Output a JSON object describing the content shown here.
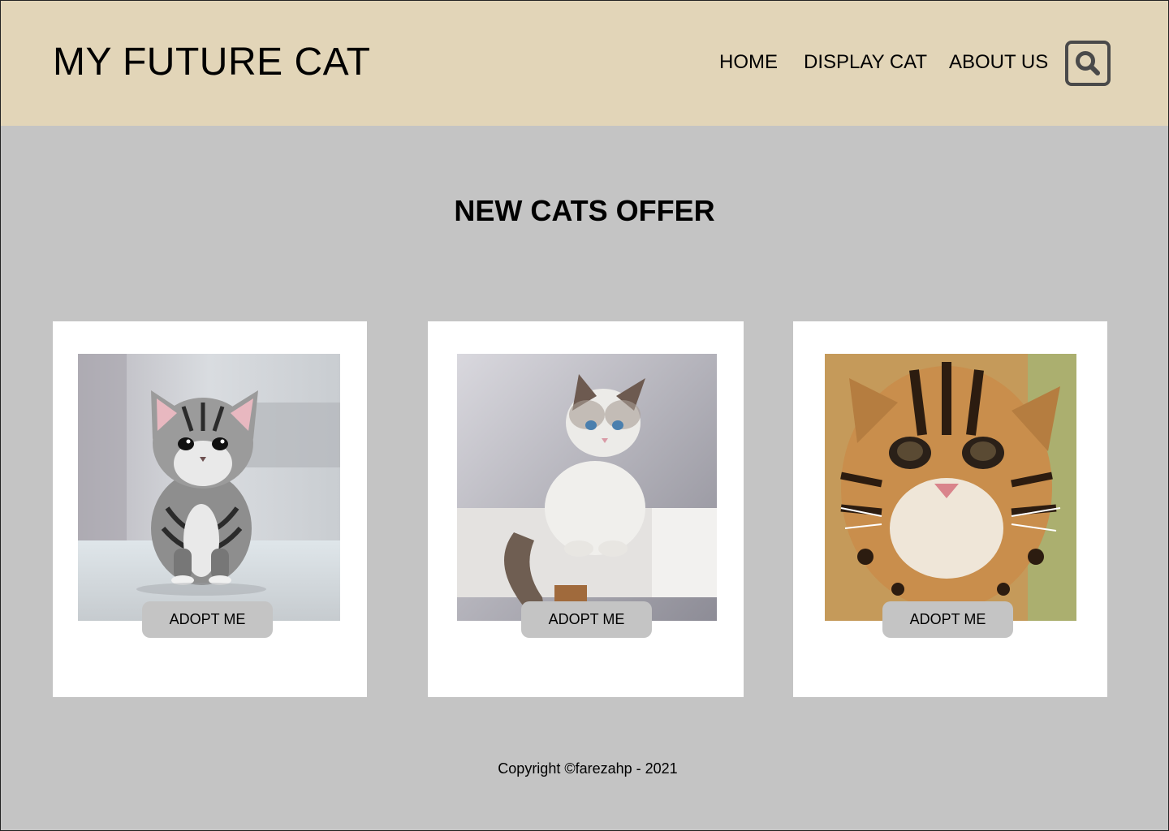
{
  "header": {
    "logo": "MY FUTURE CAT",
    "nav": [
      {
        "label": "HOME"
      },
      {
        "label": "DISPLAY CAT"
      },
      {
        "label": "ABOUT US"
      }
    ],
    "search_icon": "search-icon"
  },
  "main": {
    "title": "NEW CATS OFFER",
    "cards": [
      {
        "image": "silver-tabby-kitten",
        "button_label": "ADOPT ME"
      },
      {
        "image": "white-ragdoll-kitten",
        "button_label": "ADOPT ME"
      },
      {
        "image": "leopard-cat",
        "button_label": "ADOPT ME"
      }
    ]
  },
  "footer": {
    "copyright": "Copyright ©farezahp - 2021"
  },
  "colors": {
    "header_bg": "#e2d5b8",
    "page_bg": "#c4c4c4",
    "card_bg": "#ffffff",
    "button_bg": "#c4c4c4"
  }
}
